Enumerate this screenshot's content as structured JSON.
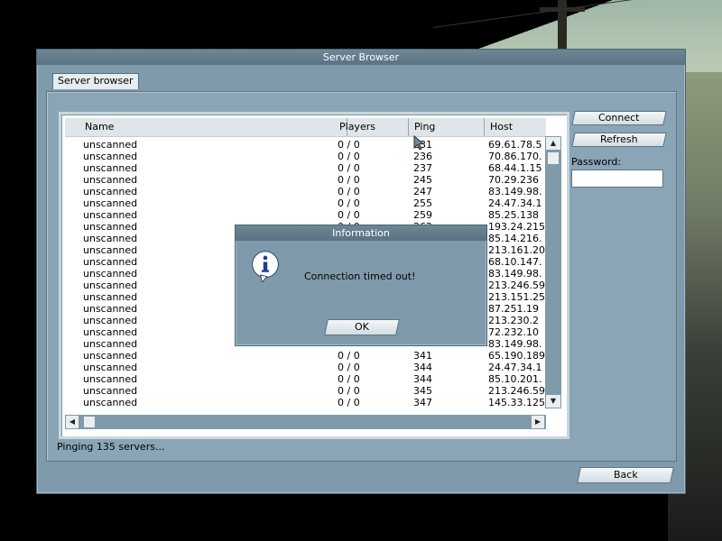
{
  "window": {
    "title": "Server Browser"
  },
  "tabs": [
    {
      "label": "Server browser"
    }
  ],
  "list": {
    "columns": [
      "Name",
      "Players",
      "Ping",
      "Host"
    ],
    "rows": [
      [
        "unscanned",
        "0 / 0",
        "231",
        "69.61.78.5"
      ],
      [
        "unscanned",
        "0 / 0",
        "236",
        "70.86.170."
      ],
      [
        "unscanned",
        "0 / 0",
        "237",
        "68.44.1.15"
      ],
      [
        "unscanned",
        "0 / 0",
        "245",
        "70.29.236"
      ],
      [
        "unscanned",
        "0 / 0",
        "247",
        "83.149.98."
      ],
      [
        "unscanned",
        "0 / 0",
        "255",
        "24.47.34.1"
      ],
      [
        "unscanned",
        "0 / 0",
        "259",
        "85.25.138"
      ],
      [
        "unscanned",
        "0 / 0",
        "262",
        "193.24.215"
      ],
      [
        "unscanned",
        "",
        "",
        "85.14.216."
      ],
      [
        "unscanned",
        "",
        "",
        "213.161.20"
      ],
      [
        "unscanned",
        "",
        "",
        "68.10.147."
      ],
      [
        "unscanned",
        "",
        "",
        "83.149.98."
      ],
      [
        "unscanned",
        "",
        "",
        "213.246.59"
      ],
      [
        "unscanned",
        "",
        "",
        "213.151.25"
      ],
      [
        "unscanned",
        "",
        "",
        "87.251.19"
      ],
      [
        "unscanned",
        "",
        "",
        "213.230.2"
      ],
      [
        "unscanned",
        "",
        "",
        "72.232.10"
      ],
      [
        "unscanned",
        "",
        "",
        "83.149.98."
      ],
      [
        "unscanned",
        "0 / 0",
        "341",
        "65.190.189"
      ],
      [
        "unscanned",
        "0 / 0",
        "344",
        "24.47.34.1"
      ],
      [
        "unscanned",
        "0 / 0",
        "344",
        "85.10.201."
      ],
      [
        "unscanned",
        "0 / 0",
        "345",
        "213.246.59"
      ],
      [
        "unscanned",
        "0 / 0",
        "347",
        "145.33.125"
      ]
    ]
  },
  "buttons": {
    "connect": "Connect",
    "refresh": "Refresh",
    "back": "Back"
  },
  "password": {
    "label": "Password:",
    "value": ""
  },
  "status": "Pinging 135 servers...",
  "dialog": {
    "title": "Information",
    "message": "Connection timed out!",
    "ok": "OK",
    "icon": "info-icon"
  },
  "colors": {
    "window": "#7f9aab",
    "titlebar": "#5a7282",
    "list_bg": "#ffffff"
  }
}
